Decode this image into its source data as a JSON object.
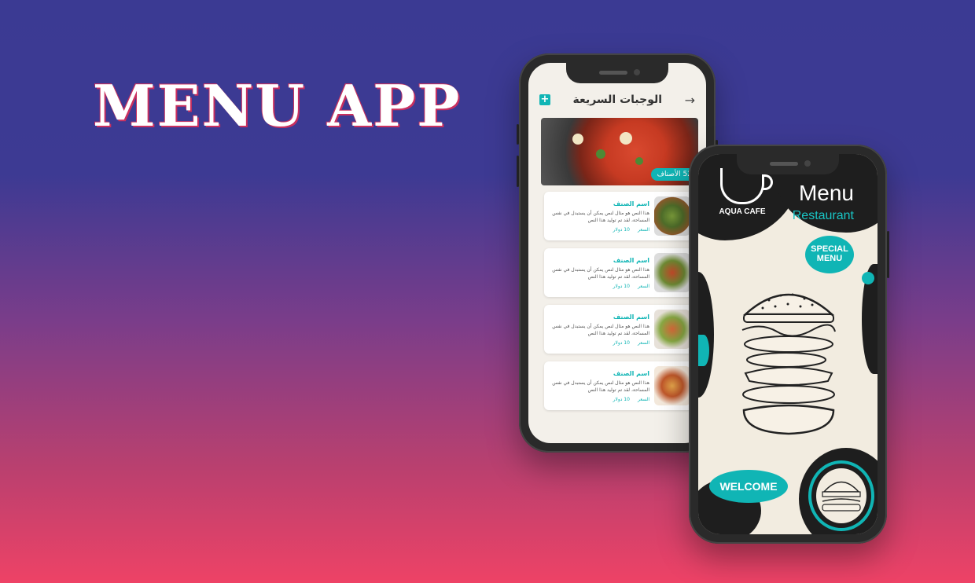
{
  "headline": "MENU APP",
  "list_screen": {
    "title": "الوجبات السريعة",
    "count_badge": "52 الأصناف",
    "items": [
      {
        "name": "اسم الصنف",
        "desc": "هذا النص هو مثال لنص يمكن أن يستبدل في نفس المساحة، لقد تم توليد هذا النص",
        "price_label": "السعر",
        "price": "10 دولار"
      },
      {
        "name": "اسم الصنف",
        "desc": "هذا النص هو مثال لنص يمكن أن يستبدل في نفس المساحة، لقد تم توليد هذا النص",
        "price_label": "السعر",
        "price": "10 دولار"
      },
      {
        "name": "اسم الصنف",
        "desc": "هذا النص هو مثال لنص يمكن أن يستبدل في نفس المساحة، لقد تم توليد هذا النص",
        "price_label": "السعر",
        "price": "10 دولار"
      },
      {
        "name": "اسم الصنف",
        "desc": "هذا النص هو مثال لنص يمكن أن يستبدل في نفس المساحة، لقد تم توليد هذا النص",
        "price_label": "السعر",
        "price": "10 دولار"
      }
    ]
  },
  "welcome_screen": {
    "brand": "AQUA CAFE",
    "menu_word": "Menu",
    "restaurant_word": "Restaurant",
    "special_line1": "SPECIAL",
    "special_line2": "MENU",
    "welcome": "WELCOME"
  },
  "colors": {
    "accent": "#10b5b5",
    "dark": "#1e1e1e",
    "headline_shadow": "#c9305f"
  }
}
